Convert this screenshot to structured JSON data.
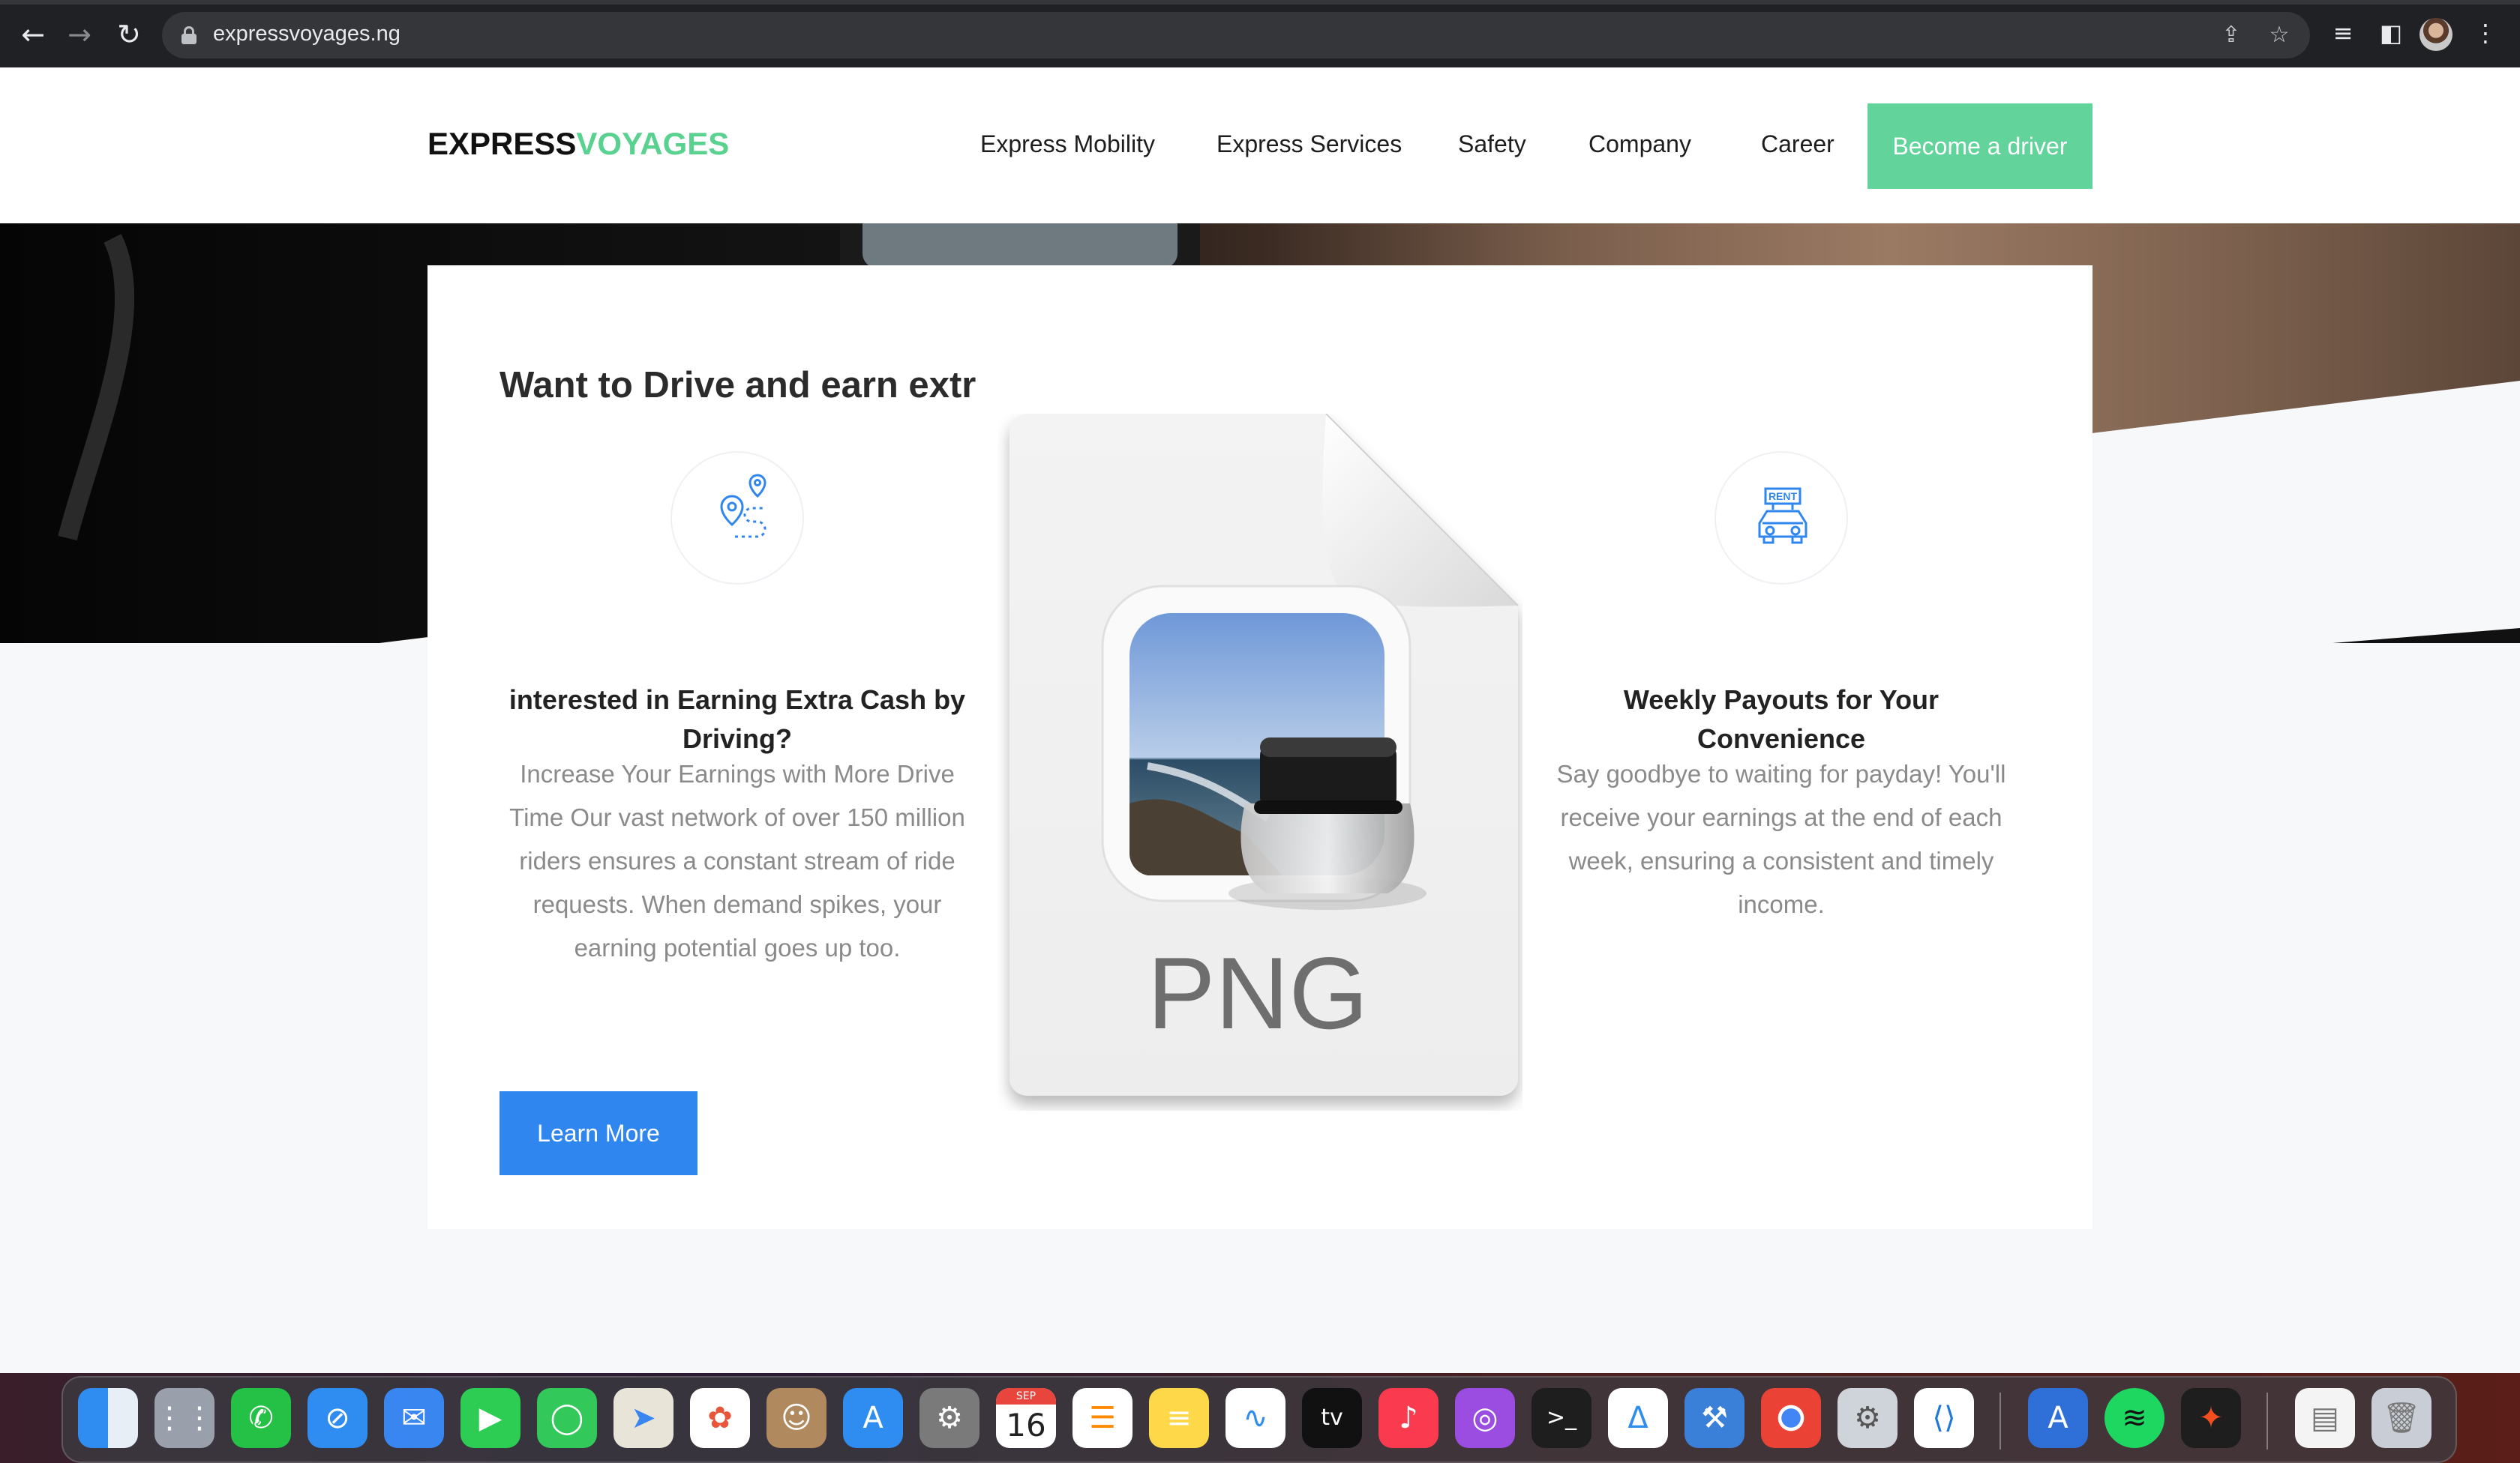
{
  "browser": {
    "url": "expressvoyages.ng"
  },
  "site": {
    "logo_part1": "EXPRESS",
    "logo_part2": "VOYAGES",
    "nav": [
      "Express Mobility",
      "Express Services",
      "Safety",
      "Company",
      "Career"
    ],
    "cta_label": "Become a driver",
    "brand_green": "#62d39a",
    "brand_blue": "#2f86ef"
  },
  "card": {
    "heading": "Want to Drive and earn extr",
    "feature1": {
      "icon": "route-pin-icon",
      "title": "interested in Earning Extra Cash by Driving?",
      "desc": "Increase Your Earnings with More Drive Time Our vast network of over 150 million riders ensures a constant stream of ride requests. When demand spikes, your earning potential goes up too."
    },
    "feature3": {
      "icon": "rent-car-icon",
      "icon_text": "RENT",
      "title": "Weekly Payouts for Your Convenience",
      "desc": "Say goodbye to waiting for payday! You'll receive your earnings at the end of each week, ensuring a consistent and timely income."
    },
    "learn_more_label": "Learn More"
  },
  "overlay": {
    "file_type_label": "PNG"
  },
  "dock": {
    "calendar_month": "SEP",
    "calendar_day": "16",
    "apple_tv_label": "tv"
  }
}
